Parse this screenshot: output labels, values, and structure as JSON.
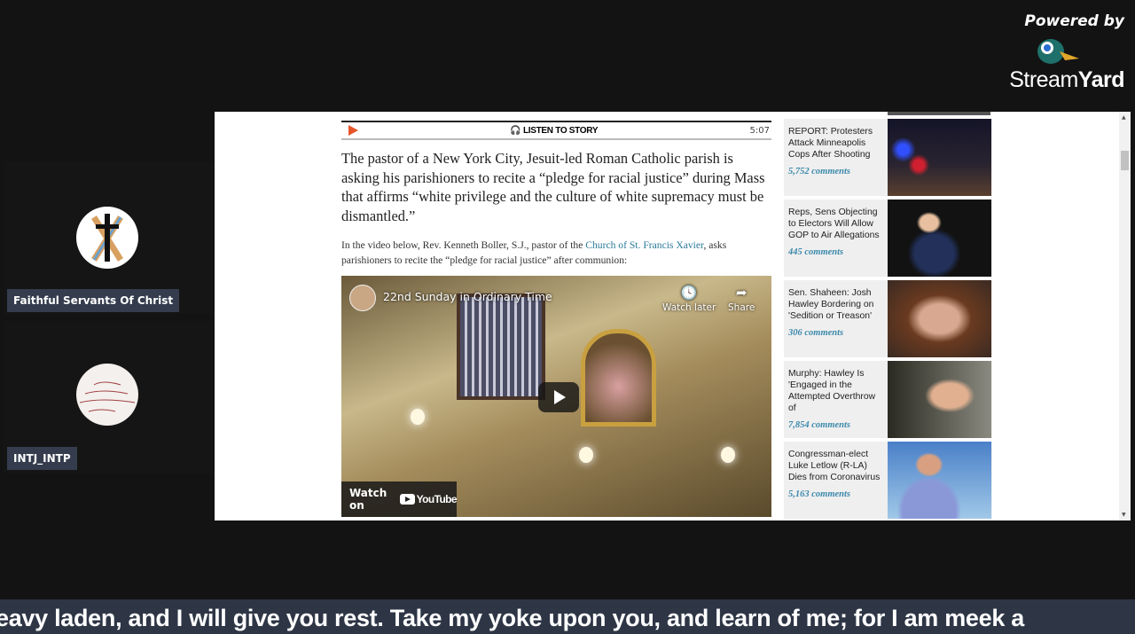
{
  "branding": {
    "powered_by": "Powered by",
    "name_light": "Stream",
    "name_bold": "Yard"
  },
  "participants": [
    {
      "name": "Faithful Servants Of Christ"
    },
    {
      "name": "INTJ_INTP"
    }
  ],
  "article": {
    "listen_label": "LISTEN TO STORY",
    "duration": "5:07",
    "lede": "The pastor of a New York City, Jesuit-led Roman Catholic parish is asking his parishioners to recite a “pledge for racial justice” during Mass that affirms “white privilege and the culture of white supremacy must be dismantled.”",
    "intro_before": "In the video below, Rev. Kenneth Boller, S.J., pastor of the ",
    "intro_link": "Church of St. Francis Xavier",
    "intro_after": ", asks parishioners to recite the “pledge for racial justice” after communion:",
    "video": {
      "title": "22nd Sunday in Ordinary Time",
      "watch_later": "Watch later",
      "share": "Share",
      "watch_on": "Watch on",
      "youtube": "YouTube"
    }
  },
  "sidebar": {
    "stories": [
      {
        "headline": "REPORT: Protesters Attack Minneapolis Cops After Shooting",
        "comments": "5,752 comments"
      },
      {
        "headline": "Reps, Sens Objecting to Electors Will Allow GOP to Air Allegations",
        "comments": "445 comments"
      },
      {
        "headline": "Sen. Shaheen: Josh Hawley Bordering on 'Sedition or Treason'",
        "comments": "306 comments"
      },
      {
        "headline": "Murphy: Hawley Is 'Engaged in the Attempted Overthrow of",
        "comments": "7,854 comments"
      },
      {
        "headline": "Congressman-elect Luke Letlow (R-LA) Dies from Coronavirus",
        "comments": "5,163 comments"
      }
    ]
  },
  "ticker": "eavy laden, and I will give you rest. Take my yoke upon you, and learn of me; for I am meek a"
}
